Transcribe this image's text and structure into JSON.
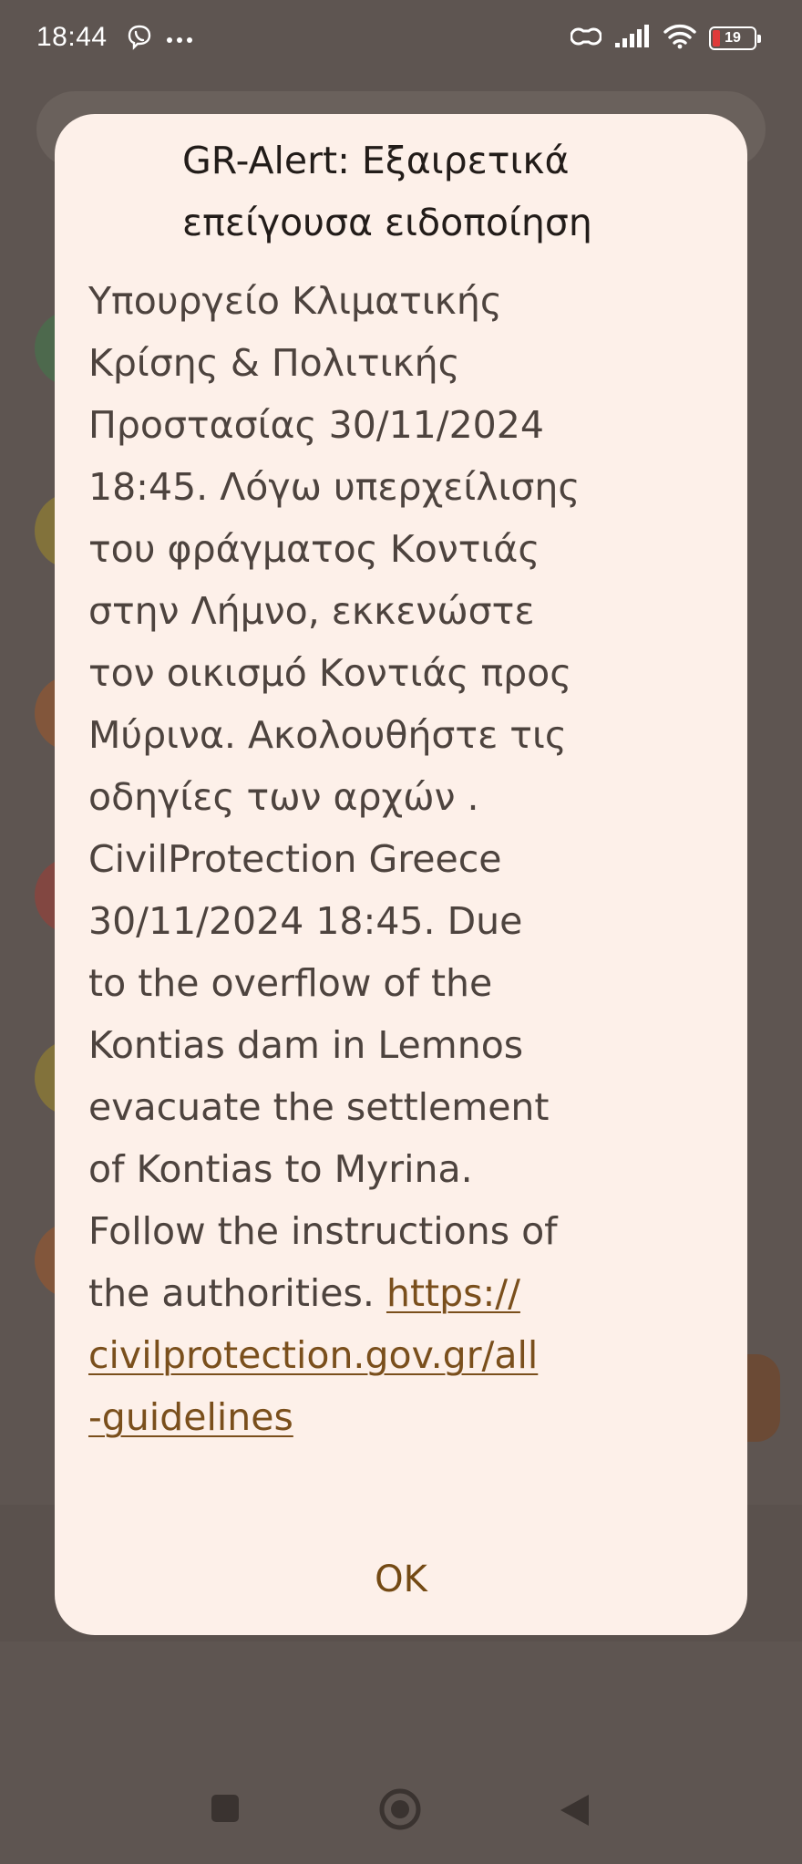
{
  "status_bar": {
    "time": "18:44",
    "left_icons": [
      "viber-icon",
      "more-dots-icon"
    ],
    "right_icons": [
      "link-icon",
      "signal-icon",
      "wifi-icon"
    ],
    "battery_level": "19",
    "battery_color": "#e03a3a"
  },
  "background_app": {
    "avatar_colors": [
      "#3f7a4a",
      "#a08a2a",
      "#a0582a",
      "#a03c35",
      "#a08a2a",
      "#a0582a"
    ]
  },
  "alert": {
    "title": "GR-Alert: Εξαιρετικά\nεπείγουσα ειδοποίηση",
    "body_lines": "Υπουργείο Κλιματικής\nΚρίσης & Πολιτικής\nΠροστασίας 30/11/2024\n18:45. Λόγω υπερχείλισης\nτου φράγματος Κοντιάς\nστην Λήμνο, εκκενώστε\nτον οικισμό Κοντιάς προς\nΜύρινα. Ακολουθήστε τις\nοδηγίες των αρχών .\nCivilProtection Greece\n30/11/2024 18:45. Due\nto the overflow  of the\nKontias dam in Lemnos\nevacuate the settlement\nof Kontias to Myrina.\nFollow the instructions of\nthe authorities. ",
    "link_text": "https://\ncivilprotection.gov.gr/all\n-guidelines",
    "ok_label": "OK",
    "background_color": "#fdf0e9",
    "link_color": "#7a4f1c"
  }
}
